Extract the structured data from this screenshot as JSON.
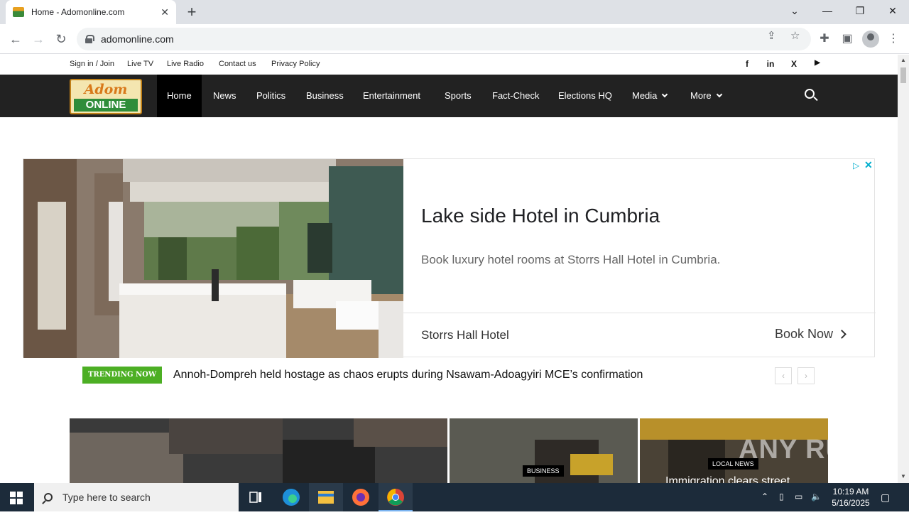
{
  "browser": {
    "tab_title": "Home - Adomonline.com",
    "url": "adomonline.com"
  },
  "topbar": {
    "links": [
      "Sign in / Join",
      "Live TV",
      "Live Radio",
      "Contact us",
      "Privacy Policy"
    ],
    "social": [
      "f",
      "in",
      "X",
      "▶"
    ]
  },
  "logo": {
    "top": "Adom",
    "bottom": "ONLINE"
  },
  "nav": {
    "items": [
      "Home",
      "News",
      "Politics",
      "Business",
      "Entertainment",
      "Sports",
      "Fact-Check",
      "Elections HQ",
      "Media",
      "More"
    ]
  },
  "ad": {
    "headline": "Lake side Hotel in Cumbria",
    "description": "Book luxury hotel rooms at Storrs Hall Hotel in Cumbria.",
    "advertiser": "Storrs Hall Hotel",
    "cta": "Book Now"
  },
  "trending": {
    "badge": "TRENDING NOW",
    "headline": "Annoh-Dompreh held hostage as chaos erupts during Nsawam-Adoagyiri MCE’s confirmation"
  },
  "featured": {
    "label_business": "BUSINESS",
    "label_local": "LOCAL NEWS",
    "title_local": "Immigration clears street"
  },
  "watermark": "ANY RUN",
  "taskbar": {
    "search_placeholder": "Type here to search",
    "time": "10:19 AM",
    "date": "5/16/2025"
  }
}
